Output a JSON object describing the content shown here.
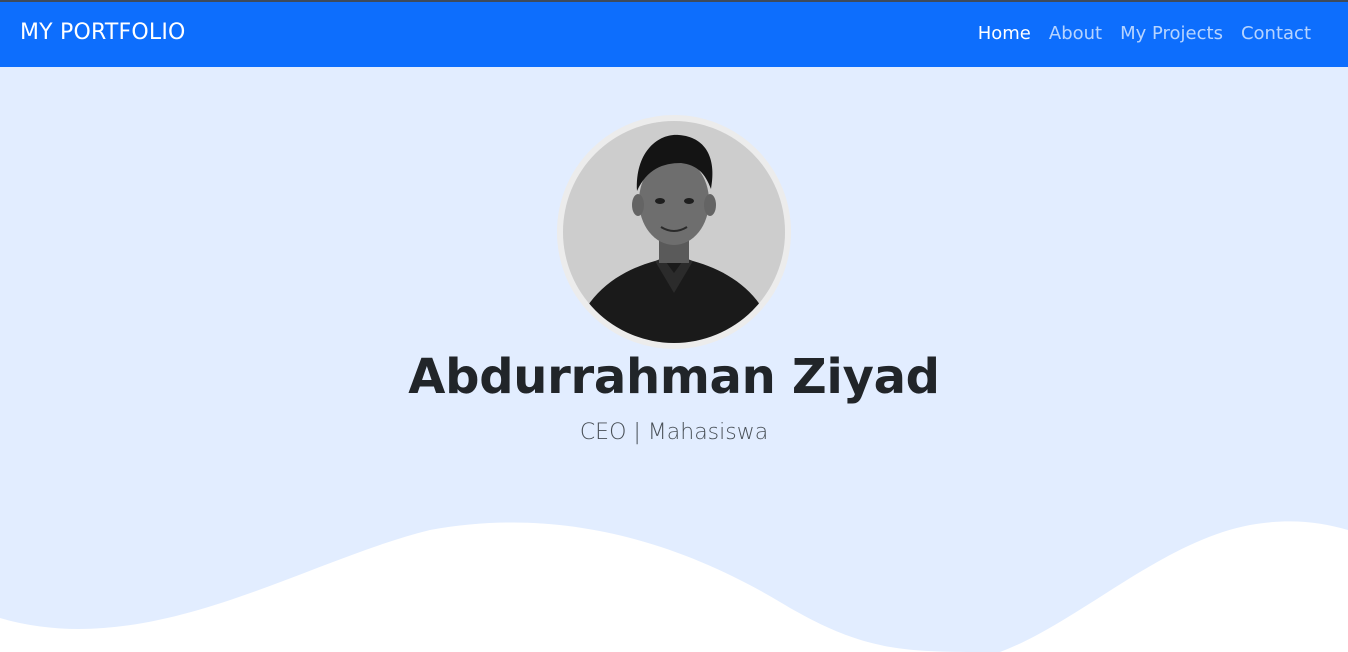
{
  "navbar": {
    "brand": "MY PORTFOLIO",
    "links": [
      {
        "label": "Home",
        "active": true
      },
      {
        "label": "About",
        "active": false
      },
      {
        "label": "My Projects",
        "active": false
      },
      {
        "label": "Contact",
        "active": false
      }
    ]
  },
  "hero": {
    "name": "Abdurrahman Ziyad",
    "tagline": "CEO | Mahasiswa"
  },
  "colors": {
    "navbar": "#0d6efd",
    "hero_background": "#e2edff",
    "wave": "#ffffff"
  }
}
